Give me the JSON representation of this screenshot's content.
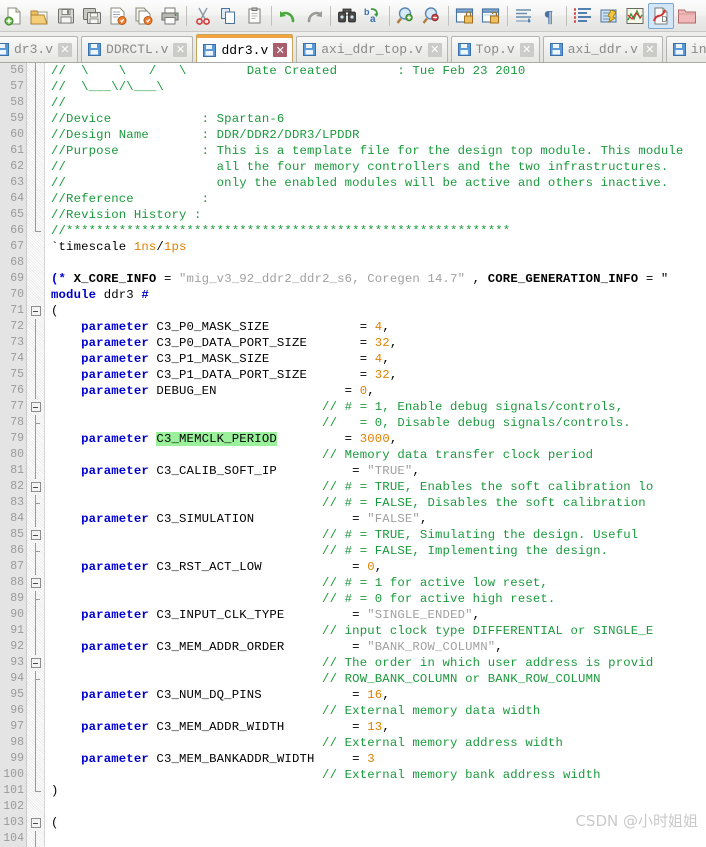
{
  "toolbar": {
    "groups": [
      {
        "buttons": [
          {
            "name": "new-file-icon",
            "label": "New"
          },
          {
            "name": "open-folder-icon",
            "label": "Open"
          },
          {
            "name": "save-icon",
            "label": "Save"
          },
          {
            "name": "save-all-icon",
            "label": "Save All"
          },
          {
            "name": "save-as-icon",
            "label": "Save As"
          },
          {
            "name": "save-copy-icon",
            "label": "Save a Copy"
          },
          {
            "name": "print-icon",
            "label": "Print"
          }
        ]
      },
      {
        "buttons": [
          {
            "name": "cut-icon",
            "label": "Cut"
          },
          {
            "name": "copy-icon",
            "label": "Copy"
          },
          {
            "name": "paste-icon",
            "label": "Paste"
          }
        ]
      },
      {
        "buttons": [
          {
            "name": "undo-icon",
            "label": "Undo"
          },
          {
            "name": "redo-icon",
            "label": "Redo"
          }
        ]
      },
      {
        "buttons": [
          {
            "name": "find-icon",
            "label": "Find"
          },
          {
            "name": "replace-icon",
            "label": "Replace"
          }
        ]
      },
      {
        "buttons": [
          {
            "name": "zoom-in-icon",
            "label": "Zoom In"
          },
          {
            "name": "zoom-out-icon",
            "label": "Zoom Out"
          }
        ]
      },
      {
        "buttons": [
          {
            "name": "lock-window-icon",
            "label": "Lock"
          },
          {
            "name": "unlock-window-icon",
            "label": "Unlock"
          }
        ]
      },
      {
        "buttons": [
          {
            "name": "indent-icon",
            "label": "Indent"
          },
          {
            "name": "paragraph-mark-icon",
            "label": "Show Formatting"
          }
        ]
      },
      {
        "buttons": [
          {
            "name": "bookmark-list-icon",
            "label": "Bookmarks"
          },
          {
            "name": "comment-block-icon",
            "label": "Comment"
          },
          {
            "name": "waveform-icon",
            "label": "Waveform"
          },
          {
            "name": "check-syntax-icon",
            "label": "Check Syntax",
            "selected": true
          },
          {
            "name": "project-folder-icon",
            "label": "Project"
          }
        ]
      }
    ]
  },
  "tabs": [
    {
      "name": "dr3.v",
      "active": false,
      "clipped": true,
      "icon": "file-verilog-icon"
    },
    {
      "name": "DDRCTL.v",
      "active": false,
      "clipped": false,
      "icon": "file-verilog-icon"
    },
    {
      "name": "ddr3.v",
      "active": true,
      "clipped": false,
      "icon": "file-verilog-icon"
    },
    {
      "name": "axi_ddr_top.v",
      "active": false,
      "clipped": false,
      "icon": "file-verilog-icon"
    },
    {
      "name": "Top.v",
      "active": false,
      "clipped": false,
      "icon": "file-verilog-icon"
    },
    {
      "name": "axi_ddr.v",
      "active": false,
      "clipped": false,
      "icon": "file-verilog-icon"
    },
    {
      "name": "infra",
      "active": false,
      "clipped": false,
      "icon": "file-verilog-icon"
    }
  ],
  "tab_close_glyph": "✕",
  "editor": {
    "first_line_number": 56,
    "line_numbers": [
      56,
      57,
      58,
      59,
      60,
      61,
      62,
      63,
      64,
      65,
      66,
      67,
      68,
      69,
      70,
      71,
      72,
      73,
      74,
      75,
      76,
      77,
      78,
      79,
      80,
      81,
      82,
      83,
      84,
      85,
      86,
      87,
      88,
      89,
      90,
      91,
      92,
      93,
      94,
      95,
      96,
      97,
      98,
      99,
      100,
      101,
      102,
      103,
      104
    ],
    "lines": [
      {
        "n": 56,
        "fold": "vline",
        "tokens": [
          {
            "t": "//  \\    \\   /   \\        Date Created        : Tue Feb 23 2010",
            "c": "cmt"
          }
        ]
      },
      {
        "n": 57,
        "fold": "vline",
        "tokens": [
          {
            "t": "//  \\___\\/\\___\\",
            "c": "cmt"
          }
        ]
      },
      {
        "n": 58,
        "fold": "vline",
        "tokens": [
          {
            "t": "//",
            "c": "cmt"
          }
        ]
      },
      {
        "n": 59,
        "fold": "vline",
        "tokens": [
          {
            "t": "//Device            : Spartan-6",
            "c": "cmt"
          }
        ]
      },
      {
        "n": 60,
        "fold": "vline",
        "tokens": [
          {
            "t": "//Design Name       : DDR/DDR2/DDR3/LPDDR",
            "c": "cmt"
          }
        ]
      },
      {
        "n": 61,
        "fold": "vline",
        "tokens": [
          {
            "t": "//Purpose           : This is a template file for the design top module. This module",
            "c": "cmt"
          }
        ]
      },
      {
        "n": 62,
        "fold": "vline",
        "tokens": [
          {
            "t": "//                    all the four memory controllers and the two infrastructures. ",
            "c": "cmt"
          }
        ]
      },
      {
        "n": 63,
        "fold": "vline",
        "tokens": [
          {
            "t": "//                    only the enabled modules will be active and others inactive.",
            "c": "cmt"
          }
        ]
      },
      {
        "n": 64,
        "fold": "vline",
        "tokens": [
          {
            "t": "//Reference         :",
            "c": "cmt"
          }
        ]
      },
      {
        "n": 65,
        "fold": "vline",
        "tokens": [
          {
            "t": "//Revision History :",
            "c": "cmt"
          }
        ]
      },
      {
        "n": 66,
        "fold": "endfold",
        "tokens": [
          {
            "t": "//***********************************************************",
            "c": "cmt"
          }
        ]
      },
      {
        "n": 67,
        "fold": "none",
        "tokens": [
          {
            "t": "`timescale ",
            "c": "plain"
          },
          {
            "t": "1ns",
            "c": "num"
          },
          {
            "t": "/",
            "c": "plain"
          },
          {
            "t": "1ps",
            "c": "num"
          }
        ]
      },
      {
        "n": 68,
        "fold": "none",
        "tokens": []
      },
      {
        "n": 69,
        "fold": "none",
        "tokens": [
          {
            "t": "(* ",
            "c": "kw"
          },
          {
            "t": "X_CORE_INFO",
            "c": "bold"
          },
          {
            "t": " = ",
            "c": "plain"
          },
          {
            "t": "\"mig_v3_92_ddr2_ddr2_s6, Coregen 14.7\"",
            "c": "str"
          },
          {
            "t": " , ",
            "c": "plain"
          },
          {
            "t": "CORE_GENERATION_INFO",
            "c": "bold"
          },
          {
            "t": " = \"",
            "c": "plain"
          }
        ]
      },
      {
        "n": 70,
        "fold": "none",
        "tokens": [
          {
            "t": "module",
            "c": "kw"
          },
          {
            "t": " ddr3 ",
            "c": "plain"
          },
          {
            "t": "#",
            "c": "kw"
          }
        ]
      },
      {
        "n": 71,
        "fold": "boxstart",
        "tokens": [
          {
            "t": "(",
            "c": "plain"
          }
        ]
      },
      {
        "n": 72,
        "fold": "vline",
        "tokens": [
          {
            "t": "    ",
            "c": "plain"
          },
          {
            "t": "parameter",
            "c": "kw"
          },
          {
            "t": " C3_P0_MASK_SIZE            = ",
            "c": "plain"
          },
          {
            "t": "4",
            "c": "num"
          },
          {
            "t": ",",
            "c": "plain"
          }
        ]
      },
      {
        "n": 73,
        "fold": "vline",
        "tokens": [
          {
            "t": "    ",
            "c": "plain"
          },
          {
            "t": "parameter",
            "c": "kw"
          },
          {
            "t": " C3_P0_DATA_PORT_SIZE       = ",
            "c": "plain"
          },
          {
            "t": "32",
            "c": "num"
          },
          {
            "t": ",",
            "c": "plain"
          }
        ]
      },
      {
        "n": 74,
        "fold": "vline",
        "tokens": [
          {
            "t": "    ",
            "c": "plain"
          },
          {
            "t": "parameter",
            "c": "kw"
          },
          {
            "t": " C3_P1_MASK_SIZE            = ",
            "c": "plain"
          },
          {
            "t": "4",
            "c": "num"
          },
          {
            "t": ",",
            "c": "plain"
          }
        ]
      },
      {
        "n": 75,
        "fold": "vline",
        "tokens": [
          {
            "t": "    ",
            "c": "plain"
          },
          {
            "t": "parameter",
            "c": "kw"
          },
          {
            "t": " C3_P1_DATA_PORT_SIZE       = ",
            "c": "plain"
          },
          {
            "t": "32",
            "c": "num"
          },
          {
            "t": ",",
            "c": "plain"
          }
        ]
      },
      {
        "n": 76,
        "fold": "vline",
        "tokens": [
          {
            "t": "    ",
            "c": "plain"
          },
          {
            "t": "parameter",
            "c": "kw"
          },
          {
            "t": " DEBUG_EN                 = ",
            "c": "plain"
          },
          {
            "t": "0",
            "c": "num"
          },
          {
            "t": ",",
            "c": "plain"
          }
        ]
      },
      {
        "n": 77,
        "fold": "boxstart",
        "tokens": [
          {
            "t": "                                    // # = 1, Enable debug signals/controls,",
            "c": "cmt"
          }
        ]
      },
      {
        "n": 78,
        "fold": "tick",
        "tokens": [
          {
            "t": "                                    //   = 0, Disable debug signals/controls.",
            "c": "cmt"
          }
        ]
      },
      {
        "n": 79,
        "fold": "vline",
        "tokens": [
          {
            "t": "    ",
            "c": "plain"
          },
          {
            "t": "parameter",
            "c": "kw"
          },
          {
            "t": " ",
            "c": "plain"
          },
          {
            "t": "C3_MEMCLK_PERIOD",
            "c": "hl"
          },
          {
            "t": "         = ",
            "c": "plain"
          },
          {
            "t": "3000",
            "c": "num"
          },
          {
            "t": ",",
            "c": "plain"
          }
        ]
      },
      {
        "n": 80,
        "fold": "vline",
        "tokens": [
          {
            "t": "                                    // Memory data transfer clock period",
            "c": "cmt"
          }
        ]
      },
      {
        "n": 81,
        "fold": "vline",
        "tokens": [
          {
            "t": "    ",
            "c": "plain"
          },
          {
            "t": "parameter",
            "c": "kw"
          },
          {
            "t": " C3_CALIB_SOFT_IP          = ",
            "c": "plain"
          },
          {
            "t": "\"TRUE\"",
            "c": "str"
          },
          {
            "t": ",",
            "c": "plain"
          }
        ]
      },
      {
        "n": 82,
        "fold": "boxstart",
        "tokens": [
          {
            "t": "                                    // # = TRUE, Enables the soft calibration lo",
            "c": "cmt"
          }
        ]
      },
      {
        "n": 83,
        "fold": "tick",
        "tokens": [
          {
            "t": "                                    // # = FALSE, Disables the soft calibration",
            "c": "cmt"
          }
        ]
      },
      {
        "n": 84,
        "fold": "vline",
        "tokens": [
          {
            "t": "    ",
            "c": "plain"
          },
          {
            "t": "parameter",
            "c": "kw"
          },
          {
            "t": " C3_SIMULATION             = ",
            "c": "plain"
          },
          {
            "t": "\"FALSE\"",
            "c": "str"
          },
          {
            "t": ",",
            "c": "plain"
          }
        ]
      },
      {
        "n": 85,
        "fold": "boxstart",
        "tokens": [
          {
            "t": "                                    // # = TRUE, Simulating the design. Useful ",
            "c": "cmt"
          }
        ]
      },
      {
        "n": 86,
        "fold": "tick",
        "tokens": [
          {
            "t": "                                    // # = FALSE, Implementing the design.",
            "c": "cmt"
          }
        ]
      },
      {
        "n": 87,
        "fold": "vline",
        "tokens": [
          {
            "t": "    ",
            "c": "plain"
          },
          {
            "t": "parameter",
            "c": "kw"
          },
          {
            "t": " C3_RST_ACT_LOW            = ",
            "c": "plain"
          },
          {
            "t": "0",
            "c": "num"
          },
          {
            "t": ",",
            "c": "plain"
          }
        ]
      },
      {
        "n": 88,
        "fold": "boxstart",
        "tokens": [
          {
            "t": "                                    // # = 1 for active low reset,",
            "c": "cmt"
          }
        ]
      },
      {
        "n": 89,
        "fold": "tick",
        "tokens": [
          {
            "t": "                                    // # = 0 for active high reset.",
            "c": "cmt"
          }
        ]
      },
      {
        "n": 90,
        "fold": "vline",
        "tokens": [
          {
            "t": "    ",
            "c": "plain"
          },
          {
            "t": "parameter",
            "c": "kw"
          },
          {
            "t": " C3_INPUT_CLK_TYPE         = ",
            "c": "plain"
          },
          {
            "t": "\"SINGLE_ENDED\"",
            "c": "str"
          },
          {
            "t": ",",
            "c": "plain"
          }
        ]
      },
      {
        "n": 91,
        "fold": "vline",
        "tokens": [
          {
            "t": "                                    // input clock type DIFFERENTIAL or SINGLE_E",
            "c": "cmt"
          }
        ]
      },
      {
        "n": 92,
        "fold": "vline",
        "tokens": [
          {
            "t": "    ",
            "c": "plain"
          },
          {
            "t": "parameter",
            "c": "kw"
          },
          {
            "t": " C3_MEM_ADDR_ORDER         = ",
            "c": "plain"
          },
          {
            "t": "\"BANK_ROW_COLUMN\"",
            "c": "str"
          },
          {
            "t": ",",
            "c": "plain"
          }
        ]
      },
      {
        "n": 93,
        "fold": "boxstart",
        "tokens": [
          {
            "t": "                                    // The order in which user address is provid",
            "c": "cmt"
          }
        ]
      },
      {
        "n": 94,
        "fold": "tick",
        "tokens": [
          {
            "t": "                                    // ROW_BANK_COLUMN or BANK_ROW_COLUMN",
            "c": "cmt"
          }
        ]
      },
      {
        "n": 95,
        "fold": "vline",
        "tokens": [
          {
            "t": "    ",
            "c": "plain"
          },
          {
            "t": "parameter",
            "c": "kw"
          },
          {
            "t": " C3_NUM_DQ_PINS            = ",
            "c": "plain"
          },
          {
            "t": "16",
            "c": "num"
          },
          {
            "t": ",",
            "c": "plain"
          }
        ]
      },
      {
        "n": 96,
        "fold": "vline",
        "tokens": [
          {
            "t": "                                    // External memory data width",
            "c": "cmt"
          }
        ]
      },
      {
        "n": 97,
        "fold": "vline",
        "tokens": [
          {
            "t": "    ",
            "c": "plain"
          },
          {
            "t": "parameter",
            "c": "kw"
          },
          {
            "t": " C3_MEM_ADDR_WIDTH         = ",
            "c": "plain"
          },
          {
            "t": "13",
            "c": "num"
          },
          {
            "t": ",",
            "c": "plain"
          }
        ]
      },
      {
        "n": 98,
        "fold": "vline",
        "tokens": [
          {
            "t": "                                    // External memory address width",
            "c": "cmt"
          }
        ]
      },
      {
        "n": 99,
        "fold": "vline",
        "tokens": [
          {
            "t": "    ",
            "c": "plain"
          },
          {
            "t": "parameter",
            "c": "kw"
          },
          {
            "t": " C3_MEM_BANKADDR_WIDTH     = ",
            "c": "plain"
          },
          {
            "t": "3",
            "c": "num"
          }
        ]
      },
      {
        "n": 100,
        "fold": "vline",
        "tokens": [
          {
            "t": "                                    // External memory bank address width",
            "c": "cmt"
          }
        ]
      },
      {
        "n": 101,
        "fold": "endfold",
        "tokens": [
          {
            "t": ")",
            "c": "plain"
          }
        ]
      },
      {
        "n": 102,
        "fold": "none",
        "tokens": []
      },
      {
        "n": 103,
        "fold": "boxstart",
        "tokens": [
          {
            "t": "(",
            "c": "plain"
          }
        ]
      },
      {
        "n": 104,
        "fold": "vline",
        "tokens": []
      }
    ]
  },
  "watermark": "CSDN @小时姐姐",
  "colors": {
    "keyword": "#0000d0",
    "comment": "#1a9a3c",
    "number": "#e08000",
    "string": "#a0a0a0",
    "highlight": "#9bf09b",
    "active_tab_accent": "#f2a33c",
    "gutter_bg": "#e4e4e4",
    "toolbar_bg": "#ececeb",
    "watermark": "#c9c9c9"
  }
}
